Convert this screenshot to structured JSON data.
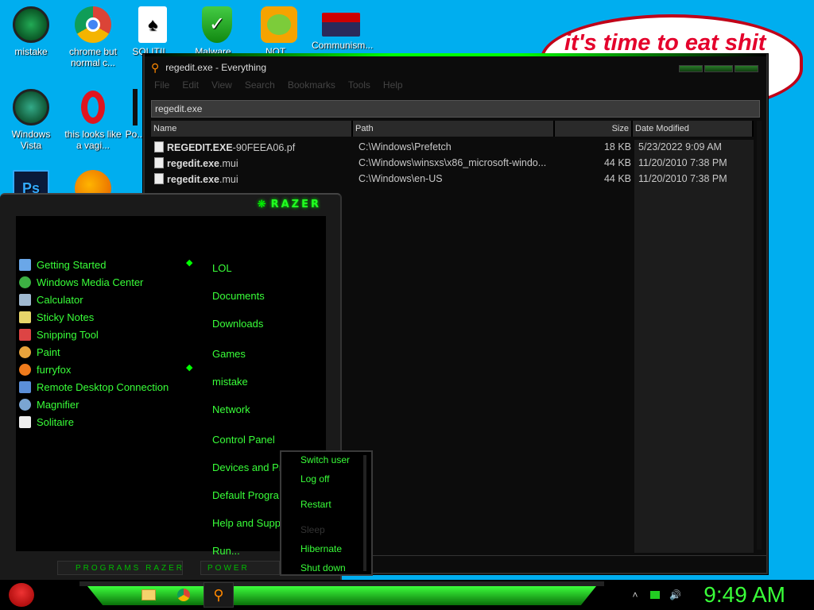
{
  "desktop": {
    "icons": [
      {
        "label": "mistake"
      },
      {
        "label": "chrome but normal c..."
      },
      {
        "label": "SOLITII..."
      },
      {
        "label": "Malware..."
      },
      {
        "label": "NOT..."
      },
      {
        "label": "Communism..."
      },
      {
        "label": "Windows Vista"
      },
      {
        "label": "this looks like a vagi..."
      },
      {
        "label": "Po..."
      }
    ],
    "bubble_text": "it's time to eat shit"
  },
  "everything": {
    "title": "regedit.exe - Everything",
    "menu": [
      "File",
      "Edit",
      "View",
      "Search",
      "Bookmarks",
      "Tools",
      "Help"
    ],
    "search_value": "regedit.exe",
    "columns": [
      "Name",
      "Path",
      "Size",
      "Date Modified"
    ],
    "rows": [
      {
        "name_bold": "REGEDIT.EXE",
        "name_rest": "-90FEEA06.pf",
        "path": "C:\\Windows\\Prefetch",
        "size": "18 KB",
        "date": "5/23/2022 9:09 AM"
      },
      {
        "name_bold": "regedit.exe",
        "name_rest": ".mui",
        "path": "C:\\Windows\\winsxs\\x86_microsoft-windo...",
        "size": "44 KB",
        "date": "11/20/2010 7:38 PM"
      },
      {
        "name_bold": "regedit.exe",
        "name_rest": ".mui",
        "path": "C:\\Windows\\en-US",
        "size": "44 KB",
        "date": "11/20/2010 7:38 PM"
      }
    ]
  },
  "start_menu": {
    "logo": "RAZER",
    "programs": [
      {
        "label": "Getting Started",
        "color": "#6aa7e8",
        "submenu": true
      },
      {
        "label": "Windows Media Center",
        "color": "#3cb043",
        "submenu": false
      },
      {
        "label": "Calculator",
        "color": "#9fb8d0",
        "submenu": false
      },
      {
        "label": "Sticky Notes",
        "color": "#e8d56a",
        "submenu": false
      },
      {
        "label": "Snipping Tool",
        "color": "#d44",
        "submenu": false
      },
      {
        "label": "Paint",
        "color": "#e8a33c",
        "submenu": false
      },
      {
        "label": "furryfox",
        "color": "#f07b1c",
        "submenu": true
      },
      {
        "label": "Remote Desktop Connection",
        "color": "#5b8fd9",
        "submenu": false
      },
      {
        "label": "Magnifier",
        "color": "#7aa5d2",
        "submenu": false
      },
      {
        "label": "Solitaire",
        "color": "#eee",
        "submenu": false
      }
    ],
    "places": [
      "LOL",
      "Documents",
      "Downloads",
      "Games",
      "mistake",
      "Network",
      "Control Panel",
      "Devices and Printers",
      "Default Progra",
      "Help and Supp",
      "Run..."
    ],
    "footer_programs": "PROGRAMS  RAZER",
    "footer_power": "POWER"
  },
  "power_menu": {
    "items": [
      {
        "label": "Switch user",
        "enabled": true
      },
      {
        "label": "Log off",
        "enabled": true
      },
      {
        "label": "Restart",
        "enabled": true
      },
      {
        "label": "Sleep",
        "enabled": false
      },
      {
        "label": "Hibernate",
        "enabled": true
      },
      {
        "label": "Shut down",
        "enabled": true
      }
    ]
  },
  "taskbar": {
    "clock": "9:49 AM"
  }
}
